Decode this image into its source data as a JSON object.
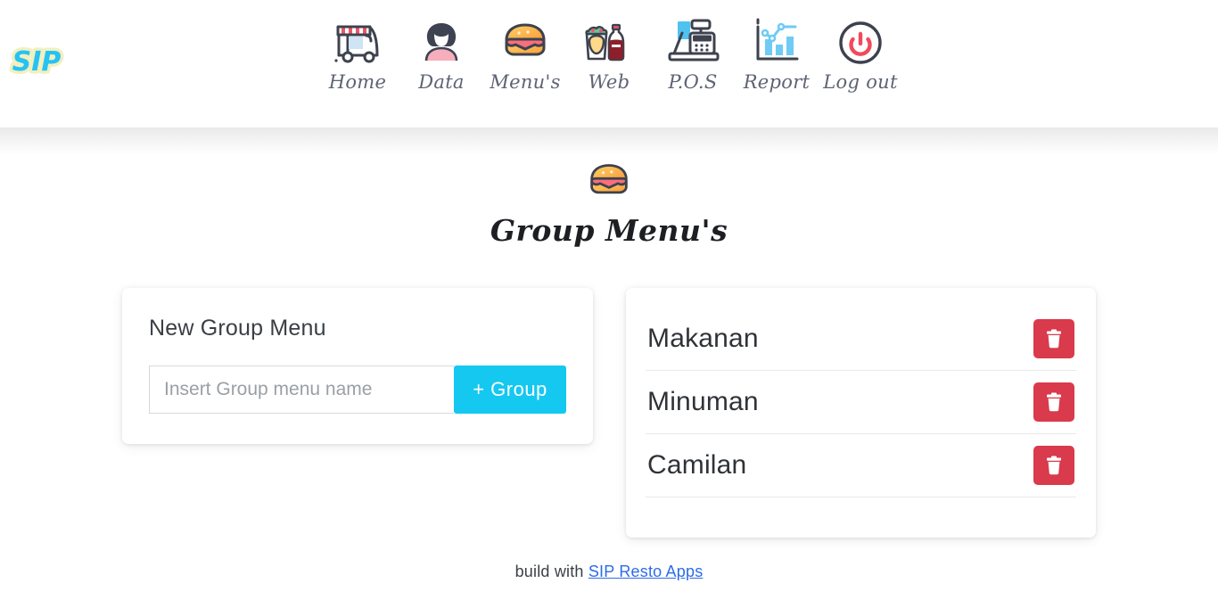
{
  "brand": {
    "logo_text": "SIP",
    "logo_colors": {
      "fill": "#25c3f3",
      "outline": "#f2efc0"
    }
  },
  "nav": {
    "items": [
      {
        "label": "Home",
        "icon": "food-truck-icon"
      },
      {
        "label": "Data",
        "icon": "person-avatar-icon"
      },
      {
        "label": "Menu's",
        "icon": "burger-icon"
      },
      {
        "label": "Web",
        "icon": "drink-and-food-icon"
      },
      {
        "label": "P.O.S",
        "icon": "cash-register-icon"
      },
      {
        "label": "Report",
        "icon": "bar-chart-icon"
      },
      {
        "label": "Log out",
        "icon": "power-icon"
      }
    ]
  },
  "page": {
    "title": "Group Menu's",
    "icon": "burger-icon"
  },
  "new_group": {
    "title": "New Group Menu",
    "input_placeholder": "Insert Group menu name",
    "input_value": "",
    "submit_label": "+ Group",
    "accent_color": "#14c8f0"
  },
  "group_list": {
    "delete_color": "#d93a4c",
    "items": [
      {
        "name": "Makanan",
        "delete_label": "trash-icon"
      },
      {
        "name": "Minuman",
        "delete_label": "trash-icon"
      },
      {
        "name": "Camilan",
        "delete_label": "trash-icon"
      }
    ]
  },
  "footer": {
    "text": "build with",
    "link_text": "SIP Resto Apps",
    "link_color": "#2d6ce8"
  }
}
